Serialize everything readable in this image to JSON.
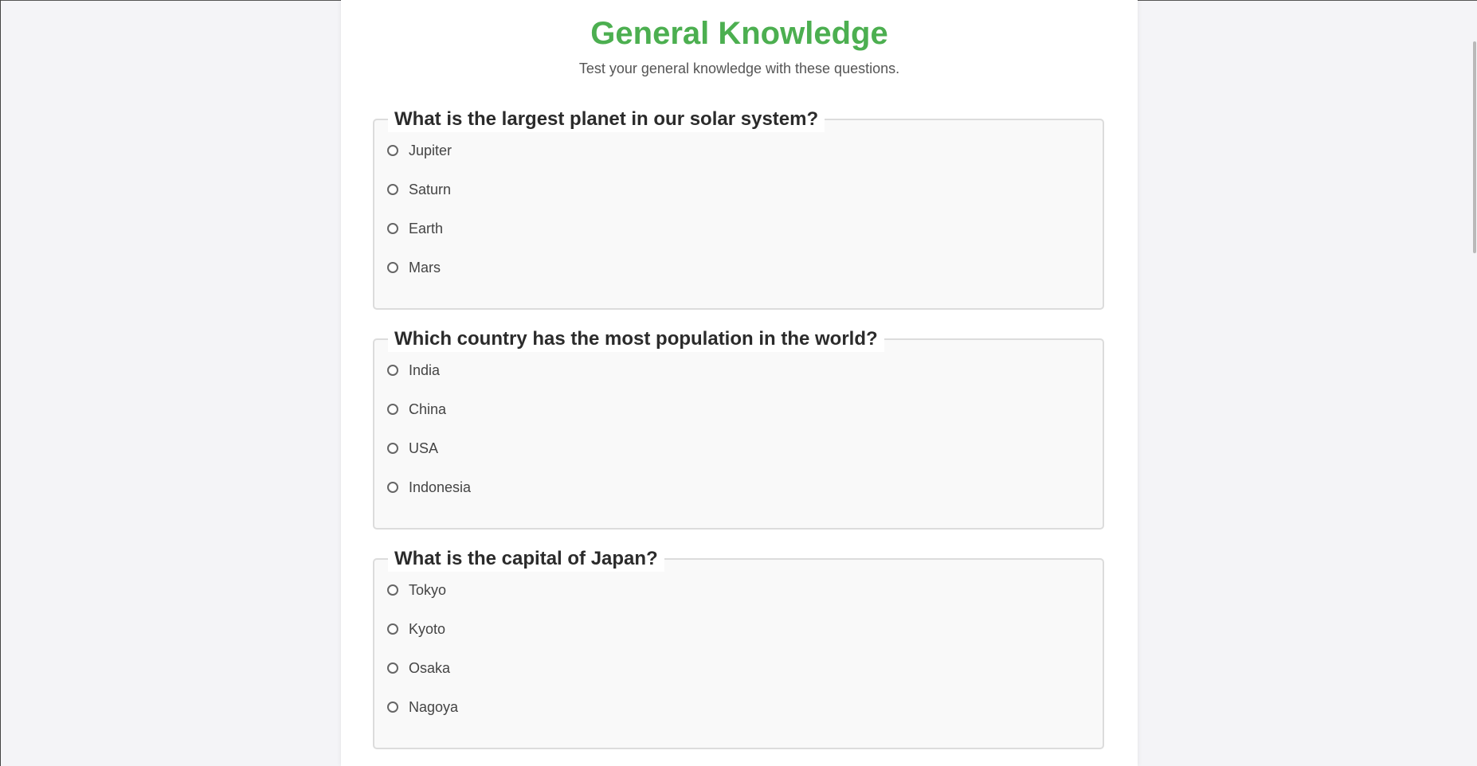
{
  "quiz": {
    "title": "General Knowledge",
    "subtitle": "Test your general knowledge with these questions.",
    "questions": [
      {
        "question": "What is the largest planet in our solar system?",
        "options": [
          "Jupiter",
          "Saturn",
          "Earth",
          "Mars"
        ]
      },
      {
        "question": "Which country has the most population in the world?",
        "options": [
          "India",
          "China",
          "USA",
          "Indonesia"
        ]
      },
      {
        "question": "What is the capital of Japan?",
        "options": [
          "Tokyo",
          "Kyoto",
          "Osaka",
          "Nagoya"
        ]
      }
    ]
  },
  "colors": {
    "title": "#4caf50",
    "page_background": "#f4f4f7",
    "card_background": "#ffffff",
    "fieldset_background": "#f9f9f9"
  }
}
